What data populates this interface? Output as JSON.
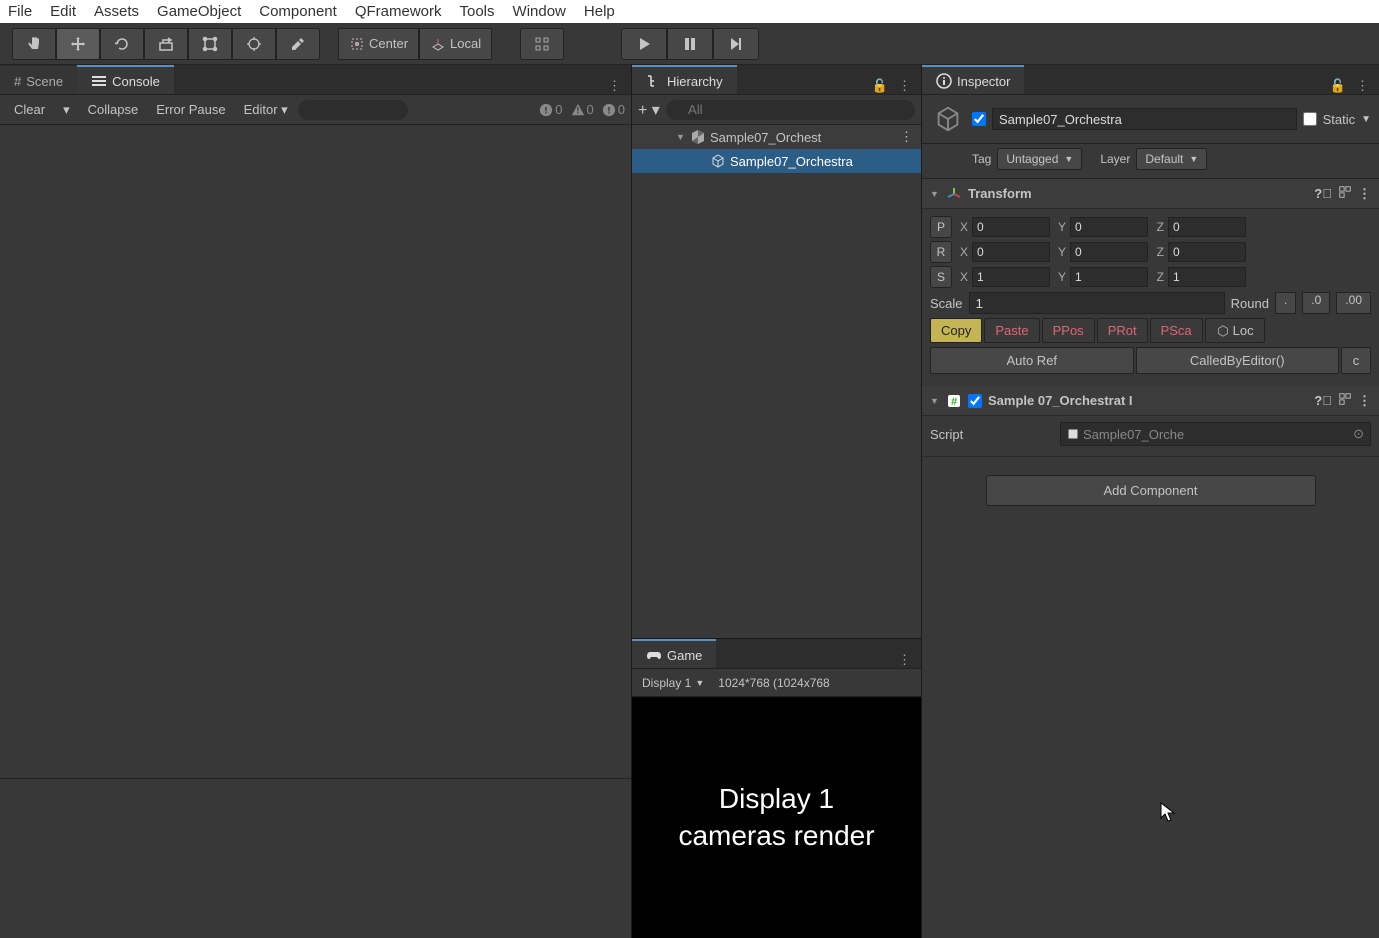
{
  "menu": [
    "File",
    "Edit",
    "Assets",
    "GameObject",
    "Component",
    "QFramework",
    "Tools",
    "Window",
    "Help"
  ],
  "toolbar": {
    "center": "Center",
    "local": "Local"
  },
  "tabs": {
    "scene": "Scene",
    "console": "Console",
    "hierarchy": "Hierarchy",
    "game": "Game",
    "inspector": "Inspector"
  },
  "console": {
    "clear": "Clear",
    "collapse": "Collapse",
    "errorPause": "Error Pause",
    "editor": "Editor",
    "info": "0",
    "warn": "0",
    "error": "0"
  },
  "hierarchy": {
    "searchPlaceholder": "All",
    "scene": "Sample07_Orchest",
    "item": "Sample07_Orchestra"
  },
  "game": {
    "display": "Display 1",
    "resolution": "1024*768 (1024x768",
    "message": "Display 1\ncameras render"
  },
  "inspector": {
    "name": "Sample07_Orchestra",
    "static": "Static",
    "tagLabel": "Tag",
    "tagValue": "Untagged",
    "layerLabel": "Layer",
    "layerValue": "Default",
    "transform": {
      "title": "Transform",
      "p": {
        "x": "0",
        "y": "0",
        "z": "0"
      },
      "r": {
        "x": "0",
        "y": "0",
        "z": "0"
      },
      "s": {
        "x": "1",
        "y": "1",
        "z": "1"
      },
      "scaleLabel": "Scale",
      "scaleVal": "1",
      "roundLabel": "Round",
      "rd": ".",
      "rd0": ".0",
      "rd00": ".00",
      "copy": "Copy",
      "paste": "Paste",
      "ppos": "PPos",
      "prot": "PRot",
      "psca": "PSca",
      "loc": "Loc",
      "autoref": "Auto Ref",
      "called": "CalledByEditor()",
      "c": "c"
    },
    "script": {
      "title": "Sample 07_Orchestrat I",
      "label": "Script",
      "value": "Sample07_Orche"
    },
    "addComponent": "Add Component"
  }
}
